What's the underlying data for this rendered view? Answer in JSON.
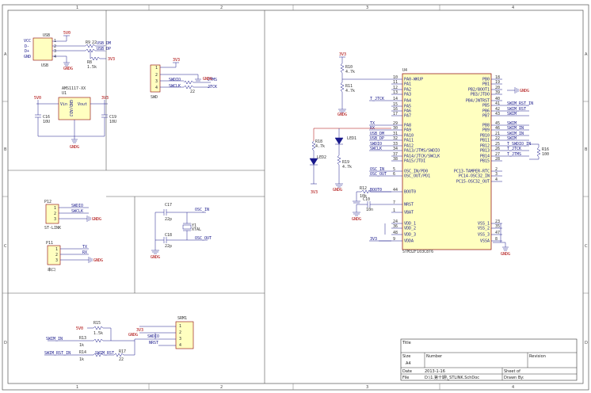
{
  "sheet": {
    "col_labels": [
      "1",
      "2",
      "3",
      "4"
    ],
    "row_labels": [
      "A",
      "B",
      "C",
      "D"
    ]
  },
  "usb": {
    "ref": "USB",
    "name": "USB",
    "pins": [
      "VCC",
      "D-",
      "D+",
      "GND"
    ],
    "pin_numbers": [
      "1",
      "2",
      "3",
      "4"
    ],
    "r9": "R9",
    "r9_val": "22",
    "r8": "R8",
    "r8_val": "1.5k",
    "net_dm": "USB_DM",
    "net_dp": "USB_DP",
    "vcc": "5V0",
    "vcc2": "3V3",
    "gnd": "GNDG"
  },
  "ldo": {
    "ref": "U1",
    "name": "AMS1117-XX",
    "pin_vin": "Vin",
    "pin_vout": "Vout",
    "pin_gnd": "GND/ADJ",
    "c16": "C16",
    "c16_val": "10U",
    "c19": "C19",
    "c19_val": "10U",
    "vin": "5V0",
    "vout": "3V3",
    "gnd": "GNDG"
  },
  "swd": {
    "ref": "SWD",
    "vcc": "3V3",
    "net_io": "SWDIO",
    "net_clk": "SWCLK",
    "net_tms": "JTMS",
    "net_tck": "JTCK",
    "r_val": "22",
    "gnd": "GNDG",
    "pins": [
      "1",
      "2",
      "3",
      "4"
    ]
  },
  "stlink": {
    "ref": "P12",
    "name": "ST-LINK",
    "nets": [
      "SWDIO",
      "SWCLK"
    ],
    "gnd": "GNDG",
    "pins": [
      "1",
      "2",
      "3"
    ]
  },
  "uart": {
    "ref": "P11",
    "name": "串口",
    "nets": [
      "TX",
      "RX"
    ],
    "gnd": "GNDG",
    "pins": [
      "1",
      "2",
      "3"
    ]
  },
  "crystal": {
    "ref": "Y1",
    "name": "XTAL",
    "c17": "C17",
    "c17_val": "22p",
    "c18": "C18",
    "c18_val": "22p",
    "net_in": "OSC_IN",
    "net_out": "OSC_OUT",
    "gnd": "GNDG"
  },
  "srm": {
    "ref": "SRM1",
    "r15": "R15",
    "r15_val": "1.5k",
    "r13": "R13",
    "r13_val": "1k",
    "r14": "R14",
    "r14_val": "1k",
    "r17": "R17",
    "r17_val": "22",
    "vcc5": "5V0",
    "vcc3": "3V3",
    "gnd": "GNDG",
    "net_tms": "SWDIO",
    "net_nrst": "NRST",
    "net_swim_in": "SWIM_IN",
    "net_swim_rst_in": "SWIM_RST_IN",
    "net_swim_rst": "SWIM_RST",
    "pins": [
      "1",
      "2",
      "3",
      "4"
    ]
  },
  "mcu": {
    "ref": "U4",
    "name": "STM32F103C8T6",
    "left_pins": [
      {
        "num": "10",
        "name": "PA0-WKUP",
        "net": ""
      },
      {
        "num": "11",
        "name": "PA1",
        "net": ""
      },
      {
        "num": "12",
        "name": "PA2",
        "net": ""
      },
      {
        "num": "13",
        "name": "PA3",
        "net": ""
      },
      {
        "num": "14",
        "name": "PA4",
        "net": "T_JTCK"
      },
      {
        "num": "15",
        "name": "PA5",
        "net": ""
      },
      {
        "num": "16",
        "name": "PA6",
        "net": ""
      },
      {
        "num": "17",
        "name": "PA7",
        "net": ""
      },
      {
        "num": "29",
        "name": "PA8",
        "net": "TX"
      },
      {
        "num": "30",
        "name": "PA9",
        "net": "RX"
      },
      {
        "num": "31",
        "name": "PA10",
        "net": "USB_DM"
      },
      {
        "num": "32",
        "name": "PA11",
        "net": "USB_DP"
      },
      {
        "num": "33",
        "name": "PA12",
        "net": "SWDIO"
      },
      {
        "num": "34",
        "name": "PA13/JTMS/SWDIO",
        "net": "SWCLK"
      },
      {
        "num": "37",
        "name": "PA14/JTCK/SWCLK",
        "net": ""
      },
      {
        "num": "38",
        "name": "PA15/JTDI",
        "net": ""
      },
      {
        "num": "5",
        "name": "OSC_IN/PD0",
        "net": "OSC_IN"
      },
      {
        "num": "6",
        "name": "OSC_OUT/PD1",
        "net": "OSC_OUT"
      },
      {
        "num": "44",
        "name": "BOOT0",
        "net": "BOOT0"
      },
      {
        "num": "7",
        "name": "NRST",
        "net": ""
      },
      {
        "num": "1",
        "name": "VBAT",
        "net": ""
      },
      {
        "num": "24",
        "name": "VDD_1",
        "net": ""
      },
      {
        "num": "36",
        "name": "VDD_2",
        "net": ""
      },
      {
        "num": "48",
        "name": "VDD_3",
        "net": ""
      },
      {
        "num": "9",
        "name": "VDDA",
        "net": "3V3"
      }
    ],
    "right_pins": [
      {
        "num": "18",
        "name": "PB0",
        "net": ""
      },
      {
        "num": "19",
        "name": "PB1",
        "net": ""
      },
      {
        "num": "20",
        "name": "PB2/BOOT1",
        "net": ""
      },
      {
        "num": "39",
        "name": "PB3/JTDO",
        "net": ""
      },
      {
        "num": "40",
        "name": "PB4/JNTRST",
        "net": ""
      },
      {
        "num": "41",
        "name": "PB5",
        "net": "SWIM_RST_IN"
      },
      {
        "num": "42",
        "name": "PB6",
        "net": "SWIM_RST"
      },
      {
        "num": "43",
        "name": "PB7",
        "net": "SWIM"
      },
      {
        "num": "45",
        "name": "PB8",
        "net": "SWIM"
      },
      {
        "num": "46",
        "name": "PB9",
        "net": "SWIM_IN"
      },
      {
        "num": "21",
        "name": "PB10",
        "net": "SWIM_IN"
      },
      {
        "num": "22",
        "name": "PB11",
        "net": "SWIM"
      },
      {
        "num": "25",
        "name": "PB12",
        "net": "T_SWDIO_IN"
      },
      {
        "num": "26",
        "name": "PB13",
        "net": "T_JTCK"
      },
      {
        "num": "27",
        "name": "PB14",
        "net": "T_JTMS"
      },
      {
        "num": "28",
        "name": "PB15",
        "net": ""
      },
      {
        "num": "2",
        "name": "PC13-TAMPER-RTC",
        "net": ""
      },
      {
        "num": "3",
        "name": "PC14-OSC32_IN",
        "net": ""
      },
      {
        "num": "4",
        "name": "PC15-OSC32_OUT",
        "net": ""
      },
      {
        "num": "23",
        "name": "VSS_1",
        "net": ""
      },
      {
        "num": "35",
        "name": "VSS_2",
        "net": ""
      },
      {
        "num": "47",
        "name": "VSS_3",
        "net": ""
      },
      {
        "num": "8",
        "name": "VSSA",
        "net": ""
      }
    ],
    "r10": "R10",
    "r10_val": "4.7k",
    "r11": "R11",
    "r11_val": "4.7k",
    "r12": "R12",
    "r12_val": "10k",
    "r18": "R18",
    "r18_val": "4.7k",
    "r19": "R19",
    "r19_val": "4.7k",
    "r16": "R16",
    "r16_val": "100",
    "led1": "LED1",
    "led2": "LED2",
    "c10": "C10",
    "c10_val": "10n",
    "vcc": "3V3",
    "gnd": "GNDG"
  },
  "title_block": {
    "title_label": "Title",
    "size_label": "Size",
    "size_value": "A4",
    "number_label": "Number",
    "number_value": "",
    "revision_label": "Revision",
    "date_label": "Date",
    "date_value": "2013-1-16",
    "file_label": "File",
    "file_value": "D:\\1.第十期\\_STLINK.SchDoc",
    "sheet_label": "Sheet  of",
    "drawn_label": "Drawn By:"
  }
}
